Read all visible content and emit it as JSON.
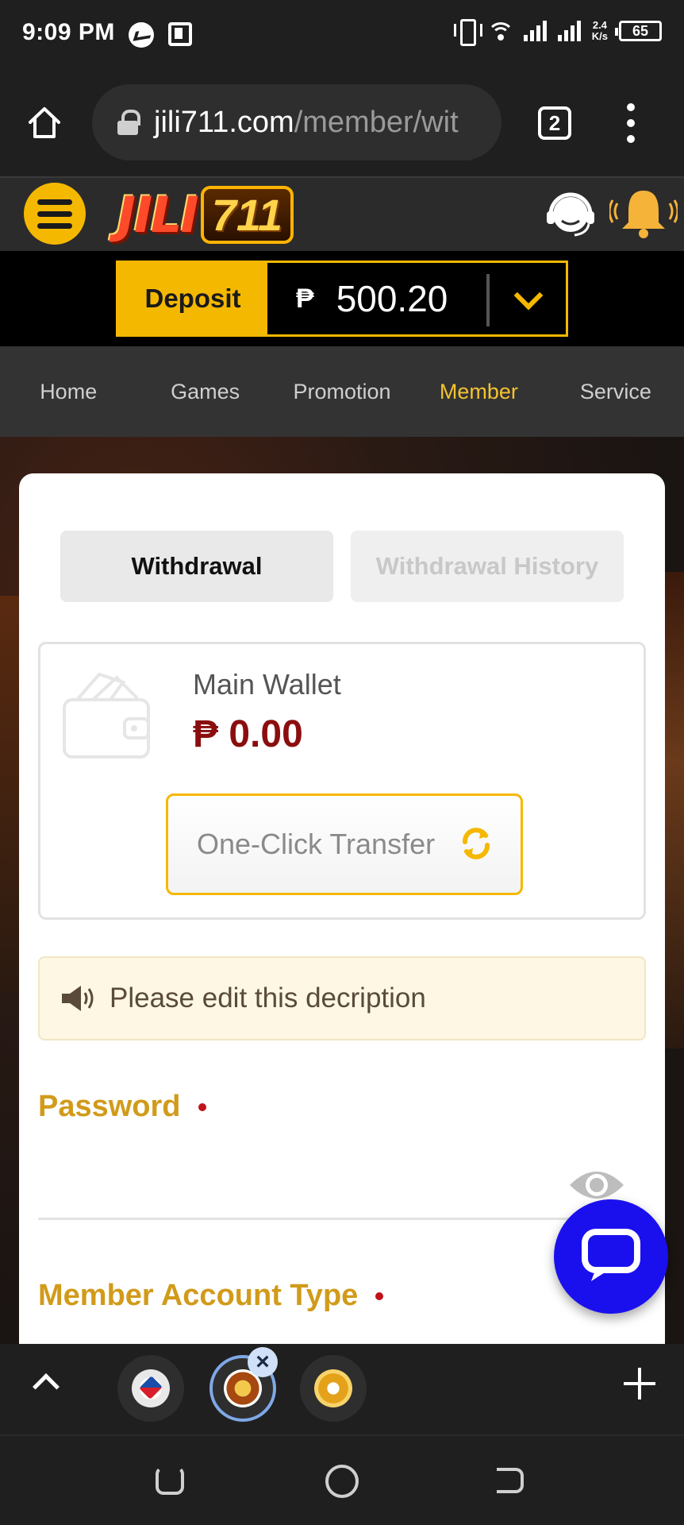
{
  "status_bar": {
    "time": "9:09 PM",
    "net_speed_value": "2.4",
    "net_speed_unit": "K/s",
    "battery": "65",
    "icons": [
      "messenger-icon",
      "pi-app-icon",
      "vibrate-icon",
      "wifi-icon",
      "signal-icon",
      "battery-icon"
    ]
  },
  "browser": {
    "url_host": "jili711.com",
    "url_path": "/member/wit",
    "tab_count": "2",
    "icons": [
      "home-icon",
      "lock-icon",
      "overflow-menu-icon"
    ]
  },
  "header": {
    "logo_text": "JILI",
    "logo_number": "711",
    "icons": [
      "hamburger-menu-icon",
      "customer-support-icon",
      "notification-bell-icon"
    ],
    "accent_color": "#f5b800"
  },
  "balance": {
    "deposit_label": "Deposit",
    "currency_symbol": "₱",
    "amount": "500.20"
  },
  "nav": {
    "items": [
      {
        "label": "Home"
      },
      {
        "label": "Games"
      },
      {
        "label": "Promotion"
      },
      {
        "label": "Member"
      },
      {
        "label": "Service"
      }
    ],
    "active": "Member",
    "active_color": "#f5c331"
  },
  "page": {
    "tabs": [
      {
        "label": "Withdrawal"
      },
      {
        "label": "Withdrawal History"
      }
    ],
    "active_tab": "Withdrawal",
    "wallet": {
      "label": "Main Wallet",
      "amount": "₱ 0.00",
      "amount_color": "#8a0e0e"
    },
    "transfer_button": "One-Click Transfer",
    "notice_text": "Please edit this decription",
    "password_label": "Password",
    "account_type_label": "Member Account Type",
    "required_color": "#c0121b"
  },
  "tab_strip": {
    "close_glyph": "×",
    "icons": [
      "collapse-up-icon",
      "add-tab-icon"
    ]
  },
  "system_nav": {
    "icons": [
      "recents-icon",
      "home-circle-icon",
      "back-icon"
    ]
  }
}
